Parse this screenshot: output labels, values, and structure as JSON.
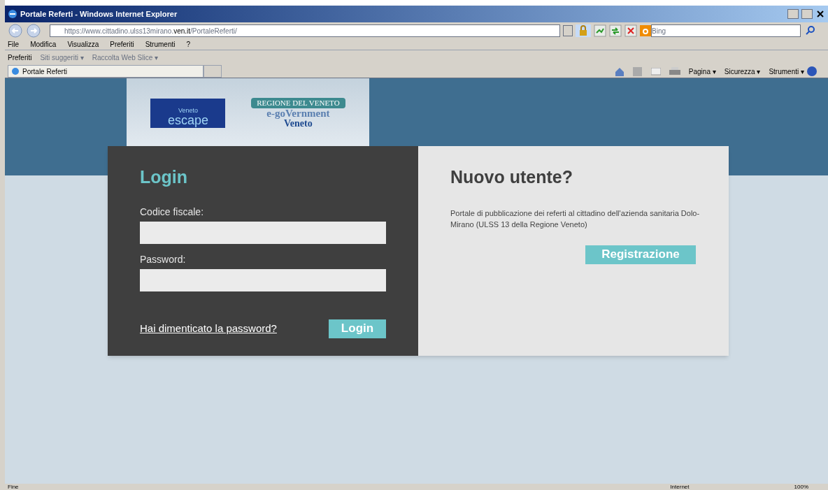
{
  "window": {
    "title": "Portale Referti - Windows Internet Explorer"
  },
  "address_bar": {
    "prefix": "https://www.cittadino.ulss13mirano.",
    "domain": "ven.it",
    "path": "/PortaleReferti/"
  },
  "search": {
    "placeholder": "Bing"
  },
  "menu": [
    "File",
    "Modifica",
    "Visualizza",
    "Preferiti",
    "Strumenti",
    "?"
  ],
  "favorites_bar": [
    {
      "label": "Preferiti",
      "disabled": false
    },
    {
      "label": "Siti suggeriti ▾",
      "disabled": true
    },
    {
      "label": "Raccolta Web Slice ▾",
      "disabled": true
    }
  ],
  "tab": {
    "label": "Portale Referti"
  },
  "command_bar": [
    "Pagina ▾",
    "Sicurezza ▾",
    "Strumenti ▾"
  ],
  "logos": {
    "escape_small": "Veneto",
    "escape_big": "escape",
    "regione": "REGIONE DEL VENETO",
    "egov_top": "e-goVernment",
    "egov_bottom": "Veneto"
  },
  "login": {
    "title": "Login",
    "fields": [
      {
        "label": "Codice fiscale:"
      },
      {
        "label": "Password:"
      }
    ],
    "forgot_link": "Hai dimenticato la password?",
    "button": "Login"
  },
  "register": {
    "title": "Nuovo utente?",
    "description": "Portale di pubblicazione dei referti al cittadino dell'azienda sanitaria Dolo-Mirano (ULSS 13 della Regione Veneto)",
    "button": "Registrazione"
  },
  "status_bar": {
    "text": "Fine",
    "zone": "Internet",
    "zoom": "100%"
  }
}
